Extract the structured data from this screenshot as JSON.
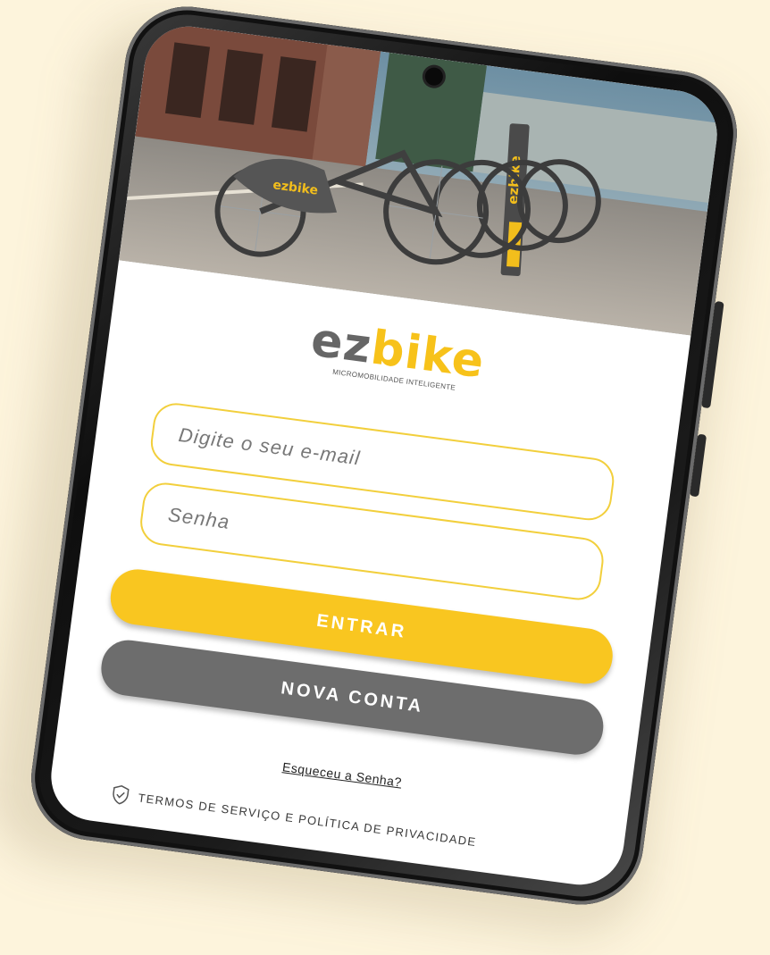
{
  "brand": {
    "logo_prefix": "ez",
    "logo_suffix": "bike",
    "tagline": "MICROMOBILIDADE INTELIGENTE",
    "colors": {
      "accent": "#f9c620",
      "logo_gray": "#666666",
      "secondary": "#6d6d6d",
      "background": "#fdf4dc"
    }
  },
  "hero": {
    "bike_brand_label": "ezbike",
    "dock_brand_label": "ezbike"
  },
  "login": {
    "email": {
      "placeholder": "Digite o seu e-mail",
      "value": ""
    },
    "password": {
      "placeholder": "Senha",
      "value": ""
    },
    "enter_label": "ENTRAR",
    "new_account_label": "NOVA CONTA",
    "forgot_password_label": "Esqueceu a Senha?"
  },
  "footer": {
    "terms_icon": "shield-check-icon",
    "terms_label": "TERMOS DE SERVIÇO E POLÍTICA DE PRIVACIDADE"
  }
}
